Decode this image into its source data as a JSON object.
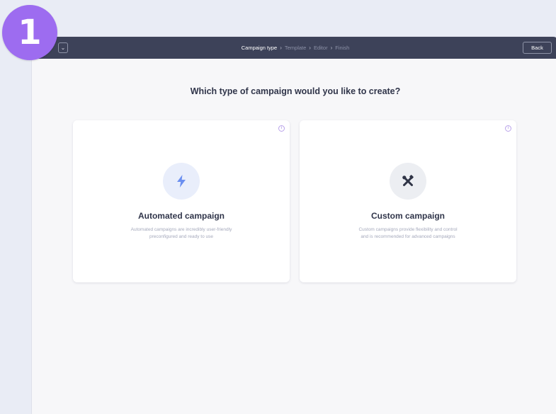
{
  "step_badge": "1",
  "toolbar": {
    "collapse_icon": "chevron-down-icon",
    "back_label": "Back"
  },
  "breadcrumb": {
    "steps": [
      "Campaign type",
      "Template",
      "Editor",
      "Finish"
    ],
    "current_index": 0
  },
  "page": {
    "heading": "Which type of campaign would you like to create?"
  },
  "cards": [
    {
      "title": "Automated campaign",
      "description_line1": "Automated campaigns are incredibly user-friendly",
      "description_line2": "preconfigured and ready to use",
      "icon": "lightning-bolt-icon",
      "info_label": "i"
    },
    {
      "title": "Custom campaign",
      "description_line1": "Custom campaigns provide flexibility and control",
      "description_line2": "and is recommended for advanced campaigns",
      "icon": "tools-icon",
      "info_label": "i"
    }
  ],
  "colors": {
    "topbar": "#3d4259",
    "badge": "#9d6cf0",
    "bolt": "#6b8ff0",
    "tools": "#2f3446"
  }
}
